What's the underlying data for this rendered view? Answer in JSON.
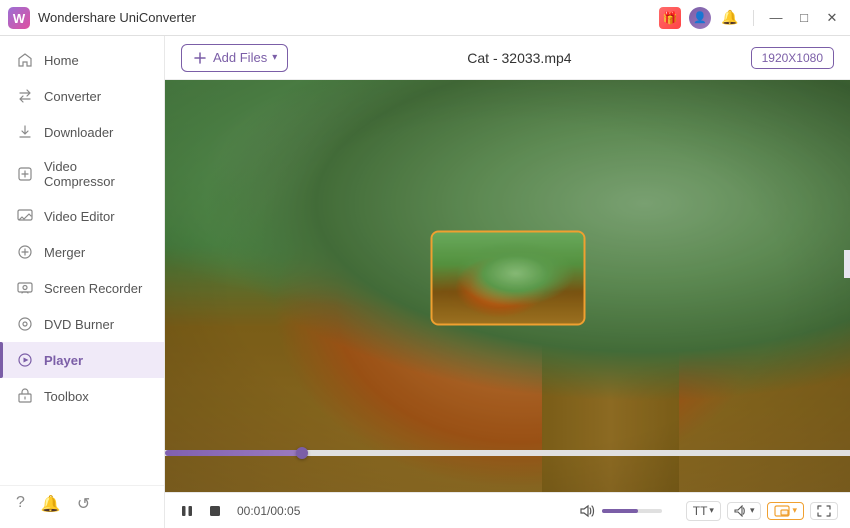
{
  "titlebar": {
    "app_name": "Wondershare UniConverter",
    "logo_text": "W"
  },
  "sidebar": {
    "items": [
      {
        "id": "home",
        "label": "Home",
        "icon": "🏠"
      },
      {
        "id": "converter",
        "label": "Converter",
        "icon": "🔄"
      },
      {
        "id": "downloader",
        "label": "Downloader",
        "icon": "⬇"
      },
      {
        "id": "video-compressor",
        "label": "Video Compressor",
        "icon": "🗜"
      },
      {
        "id": "video-editor",
        "label": "Video Editor",
        "icon": "✂"
      },
      {
        "id": "merger",
        "label": "Merger",
        "icon": "⊕"
      },
      {
        "id": "screen-recorder",
        "label": "Screen Recorder",
        "icon": "📹"
      },
      {
        "id": "dvd-burner",
        "label": "DVD Burner",
        "icon": "💿"
      },
      {
        "id": "player",
        "label": "Player",
        "icon": "▶",
        "active": true
      },
      {
        "id": "toolbox",
        "label": "Toolbox",
        "icon": "🧰"
      }
    ],
    "bottom_icons": [
      "?",
      "🔔",
      "🔄"
    ]
  },
  "content": {
    "filename": "Cat - 32033.mp4",
    "resolution": "1920X1080",
    "add_files_label": "Add Files",
    "progress_percent": 20,
    "time_current": "00:01",
    "time_total": "00:05",
    "volume_percent": 60
  },
  "controls": {
    "play_pause": "pause",
    "stop": "stop",
    "subtitle_label": "TT",
    "audio_label": "audio",
    "picture_in_picture": "pip",
    "fullscreen": "fullscreen"
  }
}
